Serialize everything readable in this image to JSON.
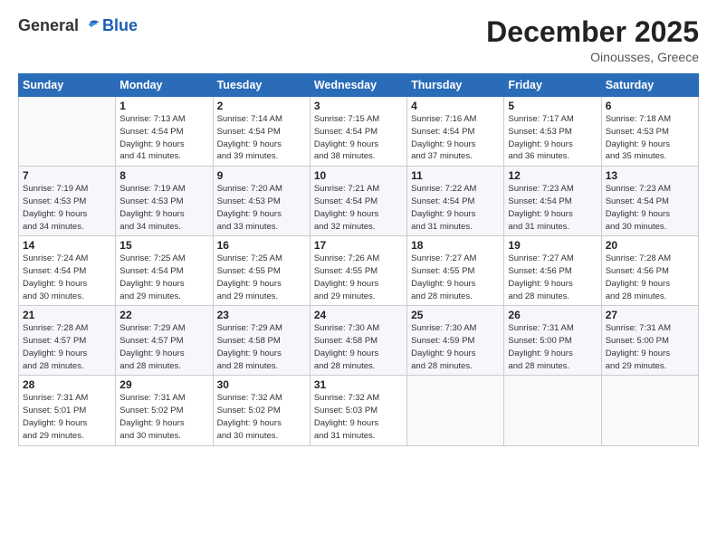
{
  "header": {
    "logo": {
      "general": "General",
      "blue": "Blue"
    },
    "title": "December 2025",
    "subtitle": "Oinousses, Greece"
  },
  "calendar": {
    "days_of_week": [
      "Sunday",
      "Monday",
      "Tuesday",
      "Wednesday",
      "Thursday",
      "Friday",
      "Saturday"
    ],
    "weeks": [
      [
        {
          "day": "",
          "info": ""
        },
        {
          "day": "1",
          "info": "Sunrise: 7:13 AM\nSunset: 4:54 PM\nDaylight: 9 hours\nand 41 minutes."
        },
        {
          "day": "2",
          "info": "Sunrise: 7:14 AM\nSunset: 4:54 PM\nDaylight: 9 hours\nand 39 minutes."
        },
        {
          "day": "3",
          "info": "Sunrise: 7:15 AM\nSunset: 4:54 PM\nDaylight: 9 hours\nand 38 minutes."
        },
        {
          "day": "4",
          "info": "Sunrise: 7:16 AM\nSunset: 4:54 PM\nDaylight: 9 hours\nand 37 minutes."
        },
        {
          "day": "5",
          "info": "Sunrise: 7:17 AM\nSunset: 4:53 PM\nDaylight: 9 hours\nand 36 minutes."
        },
        {
          "day": "6",
          "info": "Sunrise: 7:18 AM\nSunset: 4:53 PM\nDaylight: 9 hours\nand 35 minutes."
        }
      ],
      [
        {
          "day": "7",
          "info": "Sunrise: 7:19 AM\nSunset: 4:53 PM\nDaylight: 9 hours\nand 34 minutes."
        },
        {
          "day": "8",
          "info": "Sunrise: 7:19 AM\nSunset: 4:53 PM\nDaylight: 9 hours\nand 34 minutes."
        },
        {
          "day": "9",
          "info": "Sunrise: 7:20 AM\nSunset: 4:53 PM\nDaylight: 9 hours\nand 33 minutes."
        },
        {
          "day": "10",
          "info": "Sunrise: 7:21 AM\nSunset: 4:54 PM\nDaylight: 9 hours\nand 32 minutes."
        },
        {
          "day": "11",
          "info": "Sunrise: 7:22 AM\nSunset: 4:54 PM\nDaylight: 9 hours\nand 31 minutes."
        },
        {
          "day": "12",
          "info": "Sunrise: 7:23 AM\nSunset: 4:54 PM\nDaylight: 9 hours\nand 31 minutes."
        },
        {
          "day": "13",
          "info": "Sunrise: 7:23 AM\nSunset: 4:54 PM\nDaylight: 9 hours\nand 30 minutes."
        }
      ],
      [
        {
          "day": "14",
          "info": "Sunrise: 7:24 AM\nSunset: 4:54 PM\nDaylight: 9 hours\nand 30 minutes."
        },
        {
          "day": "15",
          "info": "Sunrise: 7:25 AM\nSunset: 4:54 PM\nDaylight: 9 hours\nand 29 minutes."
        },
        {
          "day": "16",
          "info": "Sunrise: 7:25 AM\nSunset: 4:55 PM\nDaylight: 9 hours\nand 29 minutes."
        },
        {
          "day": "17",
          "info": "Sunrise: 7:26 AM\nSunset: 4:55 PM\nDaylight: 9 hours\nand 29 minutes."
        },
        {
          "day": "18",
          "info": "Sunrise: 7:27 AM\nSunset: 4:55 PM\nDaylight: 9 hours\nand 28 minutes."
        },
        {
          "day": "19",
          "info": "Sunrise: 7:27 AM\nSunset: 4:56 PM\nDaylight: 9 hours\nand 28 minutes."
        },
        {
          "day": "20",
          "info": "Sunrise: 7:28 AM\nSunset: 4:56 PM\nDaylight: 9 hours\nand 28 minutes."
        }
      ],
      [
        {
          "day": "21",
          "info": "Sunrise: 7:28 AM\nSunset: 4:57 PM\nDaylight: 9 hours\nand 28 minutes."
        },
        {
          "day": "22",
          "info": "Sunrise: 7:29 AM\nSunset: 4:57 PM\nDaylight: 9 hours\nand 28 minutes."
        },
        {
          "day": "23",
          "info": "Sunrise: 7:29 AM\nSunset: 4:58 PM\nDaylight: 9 hours\nand 28 minutes."
        },
        {
          "day": "24",
          "info": "Sunrise: 7:30 AM\nSunset: 4:58 PM\nDaylight: 9 hours\nand 28 minutes."
        },
        {
          "day": "25",
          "info": "Sunrise: 7:30 AM\nSunset: 4:59 PM\nDaylight: 9 hours\nand 28 minutes."
        },
        {
          "day": "26",
          "info": "Sunrise: 7:31 AM\nSunset: 5:00 PM\nDaylight: 9 hours\nand 28 minutes."
        },
        {
          "day": "27",
          "info": "Sunrise: 7:31 AM\nSunset: 5:00 PM\nDaylight: 9 hours\nand 29 minutes."
        }
      ],
      [
        {
          "day": "28",
          "info": "Sunrise: 7:31 AM\nSunset: 5:01 PM\nDaylight: 9 hours\nand 29 minutes."
        },
        {
          "day": "29",
          "info": "Sunrise: 7:31 AM\nSunset: 5:02 PM\nDaylight: 9 hours\nand 30 minutes."
        },
        {
          "day": "30",
          "info": "Sunrise: 7:32 AM\nSunset: 5:02 PM\nDaylight: 9 hours\nand 30 minutes."
        },
        {
          "day": "31",
          "info": "Sunrise: 7:32 AM\nSunset: 5:03 PM\nDaylight: 9 hours\nand 31 minutes."
        },
        {
          "day": "",
          "info": ""
        },
        {
          "day": "",
          "info": ""
        },
        {
          "day": "",
          "info": ""
        }
      ]
    ]
  }
}
